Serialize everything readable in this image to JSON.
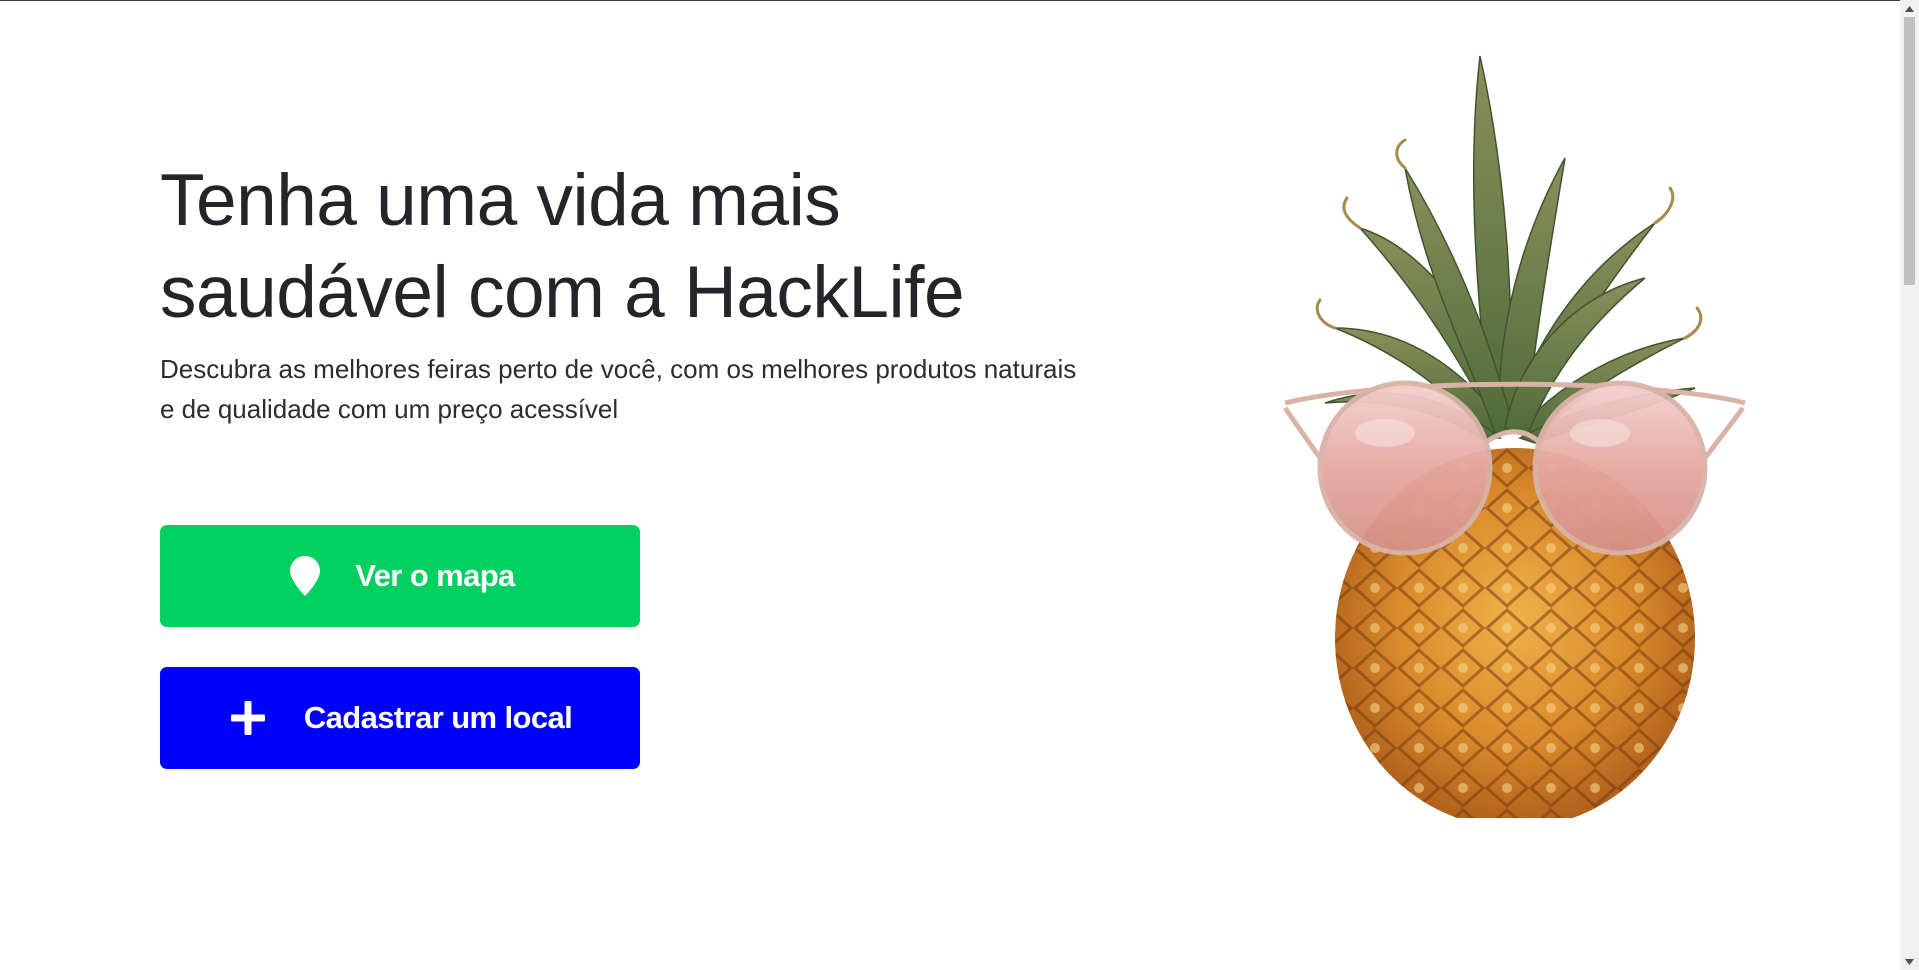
{
  "hero": {
    "title": "Tenha uma vida mais saudável com a HackLife",
    "subtitle": "Descubra as melhores feiras perto de você, com os melhores produtos naturais e de qualidade com um preço acessível"
  },
  "actions": {
    "map_button_label": "Ver o mapa",
    "map_button_icon": "map-pin-icon",
    "register_button_label": "Cadastrar um local",
    "register_button_icon": "plus-icon"
  },
  "colors": {
    "map_button": "#00d060",
    "register_button": "#0000ff",
    "text": "#23252a"
  },
  "illustration": {
    "subject": "pineapple-with-sunglasses"
  }
}
